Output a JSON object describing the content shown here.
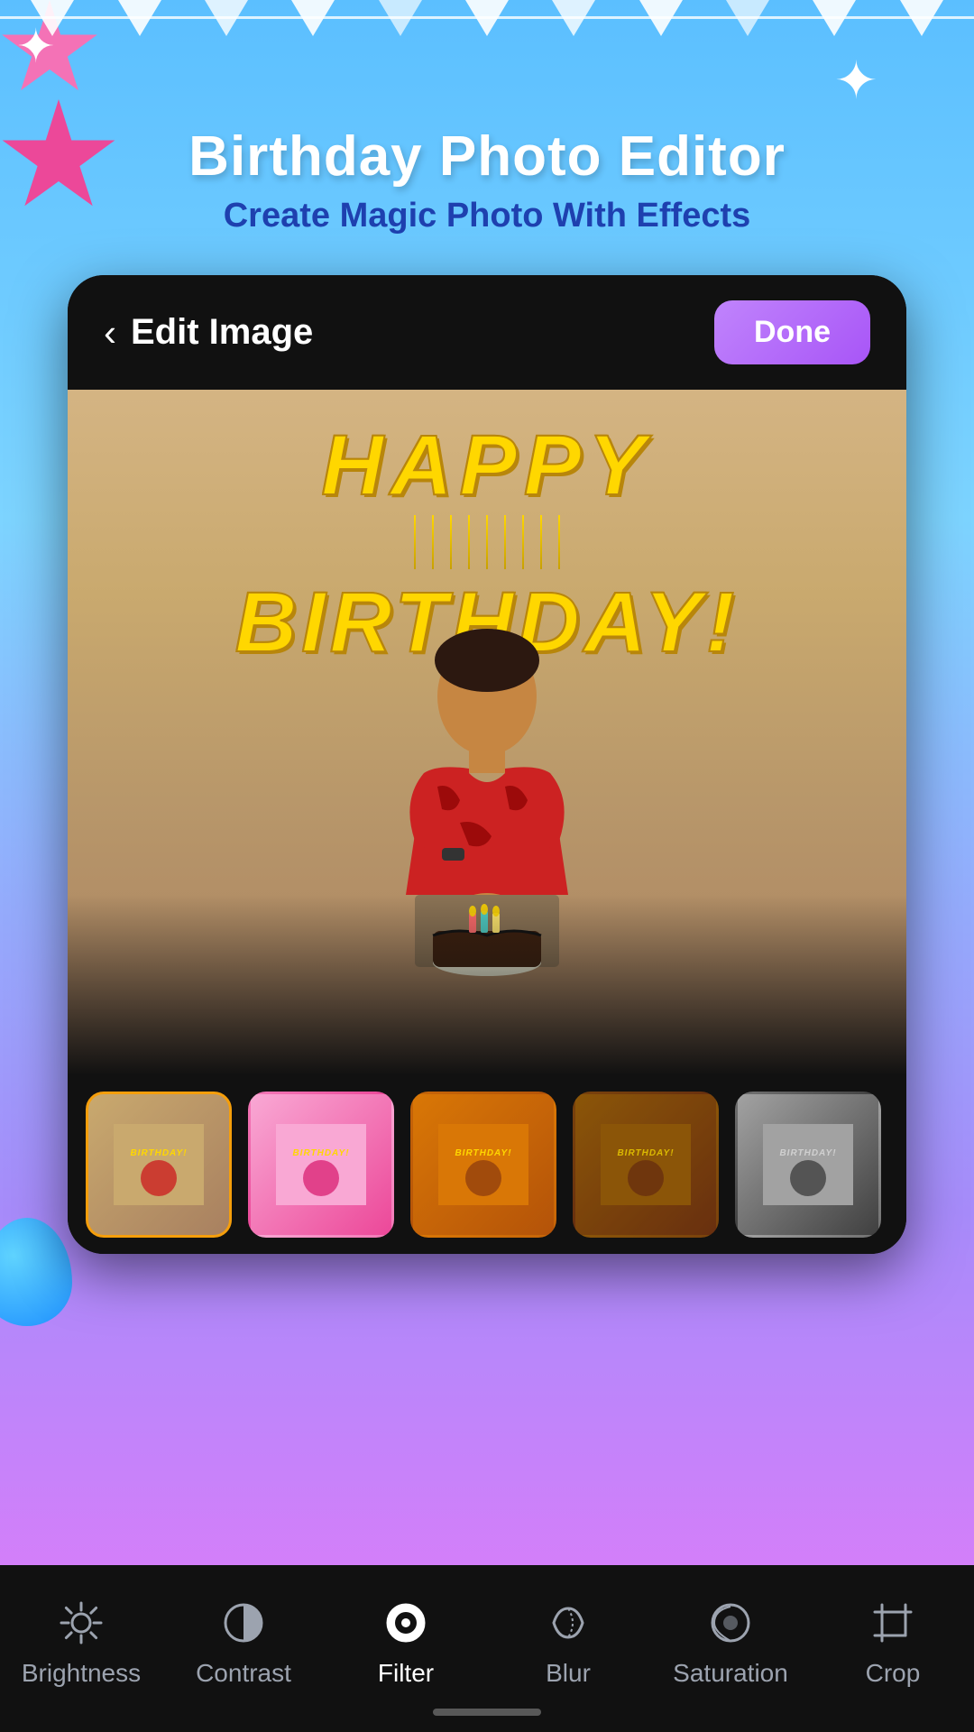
{
  "app": {
    "title": "Birthday Photo Editor",
    "subtitle": "Create Magic Photo With Effects"
  },
  "editor": {
    "header_title": "Edit Image",
    "done_label": "Done",
    "back_icon": "‹"
  },
  "photo": {
    "text_line1": "HAPPY",
    "text_line2": "BIRTHDAY!"
  },
  "filters": [
    {
      "id": "normal",
      "label": "",
      "style": "ft-normal",
      "active": true
    },
    {
      "id": "pink",
      "label": "",
      "style": "ft-pink",
      "active": false
    },
    {
      "id": "warm",
      "label": "",
      "style": "ft-warm",
      "active": false
    },
    {
      "id": "vintage",
      "label": "",
      "style": "ft-vintage",
      "active": false
    },
    {
      "id": "bw",
      "label": "",
      "style": "ft-bw",
      "active": false
    }
  ],
  "toolbar": {
    "items": [
      {
        "id": "brightness",
        "label": "Brightness",
        "active": false
      },
      {
        "id": "contrast",
        "label": "Contrast",
        "active": false
      },
      {
        "id": "filter",
        "label": "Filter",
        "active": true
      },
      {
        "id": "blur",
        "label": "Blur",
        "active": false
      },
      {
        "id": "saturation",
        "label": "Saturation",
        "active": false
      },
      {
        "id": "crop",
        "label": "Crop",
        "active": false
      }
    ]
  },
  "colors": {
    "accent": "#a855f7",
    "active_tool": "#ffffff",
    "inactive_tool": "#9ca3af",
    "done_bg": "linear-gradient(135deg, #c084fc, #a855f7)"
  }
}
